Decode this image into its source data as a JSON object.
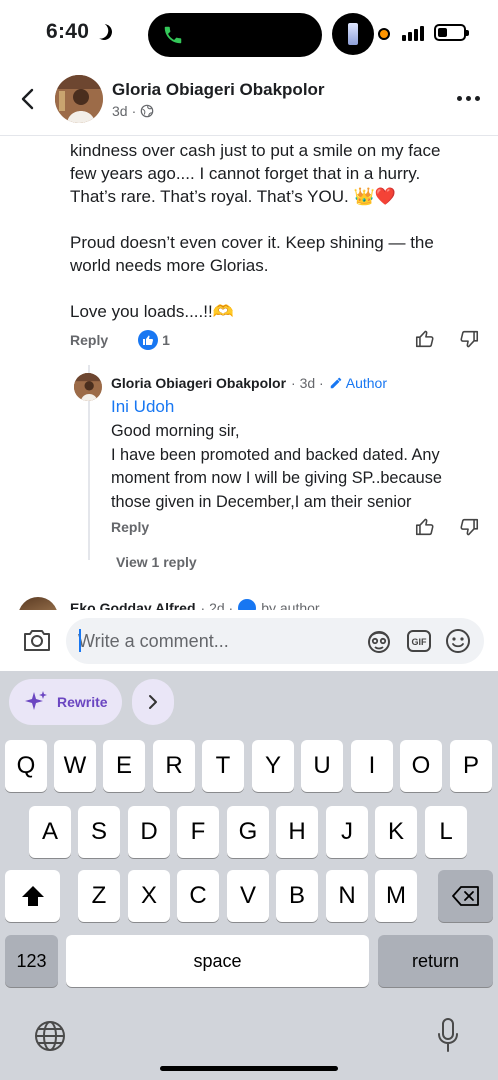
{
  "status": {
    "time": "6:40"
  },
  "header": {
    "name": "Gloria Obiageri Obakpolor",
    "age": "3d"
  },
  "comment": {
    "lines_block1": [
      "kindness over cash just to put a smile on my face",
      "few years ago.... I cannot forget that in a hurry.",
      "That’s rare. That’s royal. That’s YOU. 👑❤️"
    ],
    "lines_block2": [
      "Proud doesn’t even cover it. Keep shining — the",
      "world needs more Glorias."
    ],
    "line_block3": "Love you loads....!!🫶",
    "reply_label": "Reply",
    "like_count": "1"
  },
  "reply": {
    "name": "Gloria Obiageri Obakpolor",
    "age": "· 3d ·",
    "author_label": "Author",
    "mention": "Ini Udoh",
    "lines": [
      "Good morning sir,",
      "I have been promoted and backed dated. Any",
      "moment from now I will be giving SP..because",
      "those given in December,I am their senior"
    ],
    "reply_label": "Reply",
    "view_replies": "View 1 reply"
  },
  "next_comment": {
    "name": "Eko Godday Alfred",
    "meta": "· 2d ·",
    "badge": "by author"
  },
  "composer": {
    "placeholder": "Write a comment..."
  },
  "keyboard": {
    "rewrite_label": "Rewrite",
    "row1": [
      "Q",
      "W",
      "E",
      "R",
      "T",
      "Y",
      "U",
      "I",
      "O",
      "P"
    ],
    "row2": [
      "A",
      "S",
      "D",
      "F",
      "G",
      "H",
      "J",
      "K",
      "L"
    ],
    "row3": [
      "Z",
      "X",
      "C",
      "V",
      "B",
      "N",
      "M"
    ],
    "numbers_label": "123",
    "space_label": "space",
    "return_label": "return"
  },
  "colors": {
    "accent": "#1877f2",
    "rewrite": "#6b46c1"
  }
}
